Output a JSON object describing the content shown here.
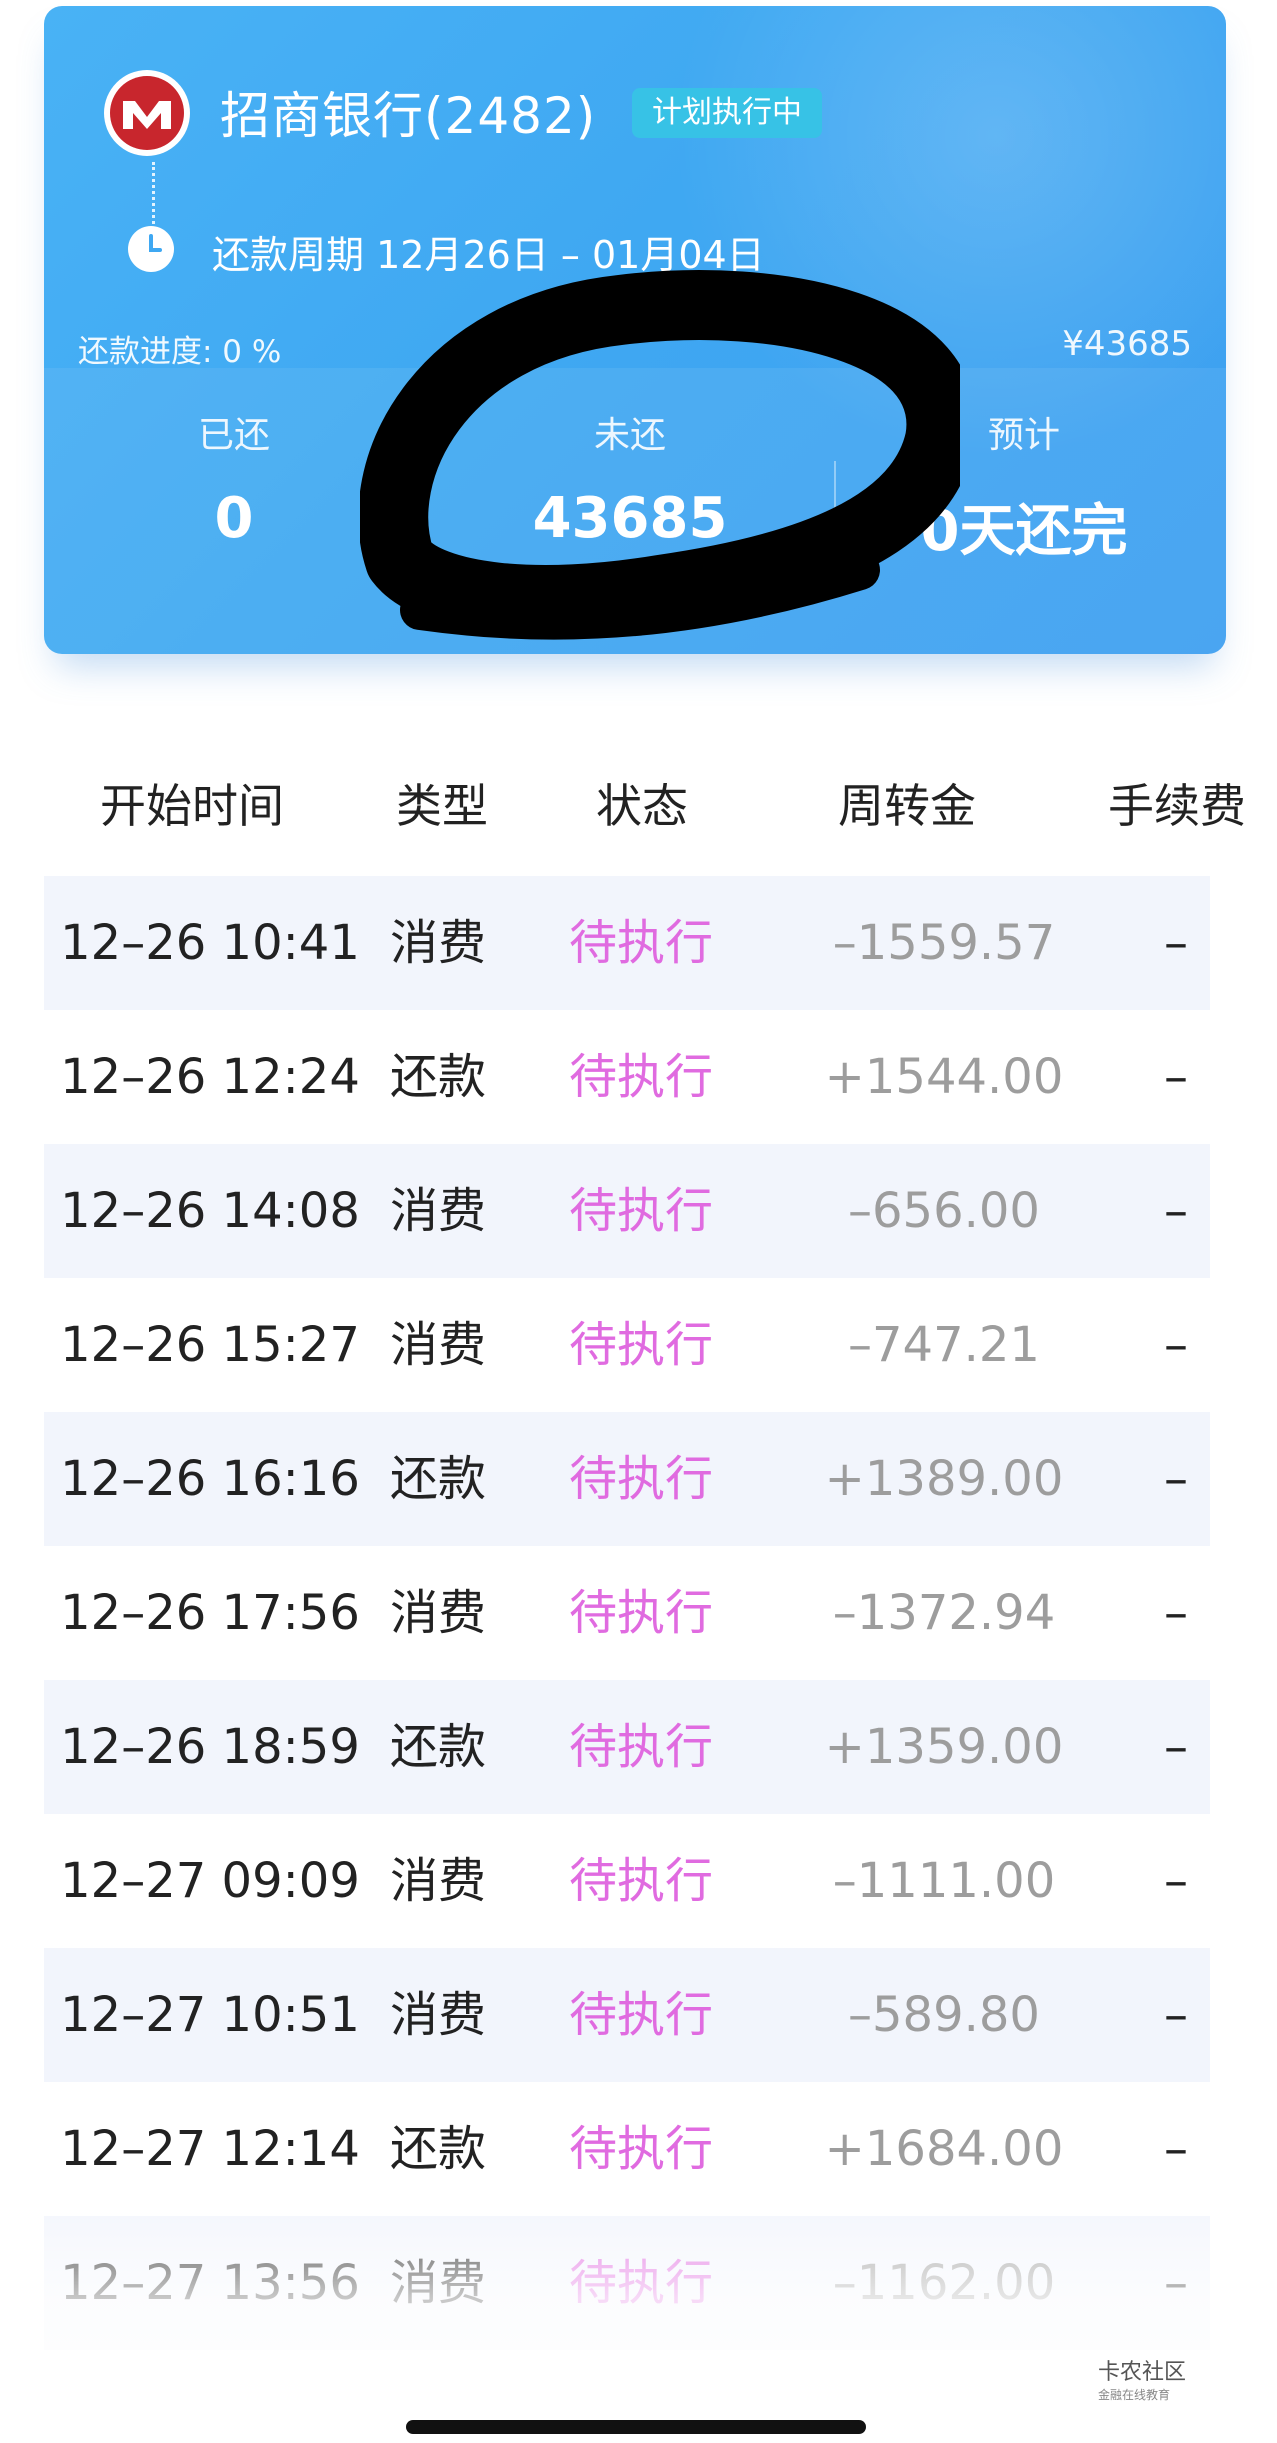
{
  "card": {
    "bank_name": "招商银行(2482)",
    "status": "计划执行中",
    "period_label": "还款周期",
    "period_value": "12月26日 – 01月04日",
    "progress_label": "还款进度: 0 %",
    "total": "¥43685",
    "stats": [
      {
        "label": "已还",
        "value": "0"
      },
      {
        "label": "未还",
        "value": "43685"
      },
      {
        "label": "预计",
        "value": "0天还完"
      }
    ],
    "colors": {
      "card": "#3fa8f2",
      "pill": "#37c2e6",
      "logo": "#c8262d"
    }
  },
  "table": {
    "headers": [
      "开始时间",
      "类型",
      "状态",
      "周转金",
      "手续费"
    ],
    "rows": [
      {
        "time": "12–26 10:41",
        "type": "消费",
        "state": "待执行",
        "amount": "–1559.57",
        "fee": "–"
      },
      {
        "time": "12–26 12:24",
        "type": "还款",
        "state": "待执行",
        "amount": "+1544.00",
        "fee": "–"
      },
      {
        "time": "12–26 14:08",
        "type": "消费",
        "state": "待执行",
        "amount": "–656.00",
        "fee": "–"
      },
      {
        "time": "12–26 15:27",
        "type": "消费",
        "state": "待执行",
        "amount": "–747.21",
        "fee": "–"
      },
      {
        "time": "12–26 16:16",
        "type": "还款",
        "state": "待执行",
        "amount": "+1389.00",
        "fee": "–"
      },
      {
        "time": "12–26 17:56",
        "type": "消费",
        "state": "待执行",
        "amount": "–1372.94",
        "fee": "–"
      },
      {
        "time": "12–26 18:59",
        "type": "还款",
        "state": "待执行",
        "amount": "+1359.00",
        "fee": "–"
      },
      {
        "time": "12–27 09:09",
        "type": "消费",
        "state": "待执行",
        "amount": "–1111.00",
        "fee": "–"
      },
      {
        "time": "12–27 10:51",
        "type": "消费",
        "state": "待执行",
        "amount": "–589.80",
        "fee": "–"
      },
      {
        "time": "12–27 12:14",
        "type": "还款",
        "state": "待执行",
        "amount": "+1684.00",
        "fee": "–"
      },
      {
        "time": "12–27 13:56",
        "type": "消费",
        "state": "待执行",
        "amount": "–1162.00",
        "fee": "–"
      }
    ],
    "colors": {
      "state": "#e06be0",
      "amount": "#9d9d9d",
      "row_alt": "#f2f5fc"
    }
  },
  "watermark": {
    "title": "卡农社区",
    "subtitle": "金融在线教育"
  }
}
